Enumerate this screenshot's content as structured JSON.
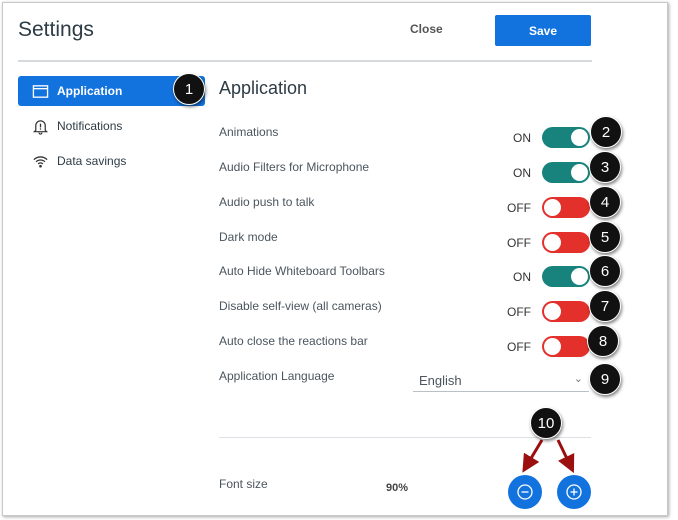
{
  "header": {
    "title": "Settings",
    "close_label": "Close",
    "save_label": "Save"
  },
  "sidebar": {
    "items": [
      {
        "label": "Application",
        "icon": "window-icon",
        "active": true
      },
      {
        "label": "Notifications",
        "icon": "bell-icon"
      },
      {
        "label": "Data savings",
        "icon": "wifi-icon"
      }
    ]
  },
  "main": {
    "heading": "Application",
    "settings": [
      {
        "label": "Animations",
        "state": "ON"
      },
      {
        "label": "Audio Filters for Microphone",
        "state": "ON"
      },
      {
        "label": "Audio push to talk",
        "state": "OFF"
      },
      {
        "label": "Dark mode",
        "state": "OFF"
      },
      {
        "label": "Auto Hide Whiteboard Toolbars",
        "state": "ON"
      },
      {
        "label": "Disable self-view (all cameras)",
        "state": "OFF"
      },
      {
        "label": "Auto close the reactions bar",
        "state": "OFF"
      }
    ],
    "language": {
      "label": "Application Language",
      "value": "English"
    },
    "font_size": {
      "label": "Font size",
      "value": "90%"
    }
  },
  "callouts": [
    "1",
    "2",
    "3",
    "4",
    "5",
    "6",
    "7",
    "8",
    "9",
    "10"
  ],
  "colors": {
    "accent": "#1273de",
    "on": "#17837c",
    "off": "#e3302b"
  }
}
